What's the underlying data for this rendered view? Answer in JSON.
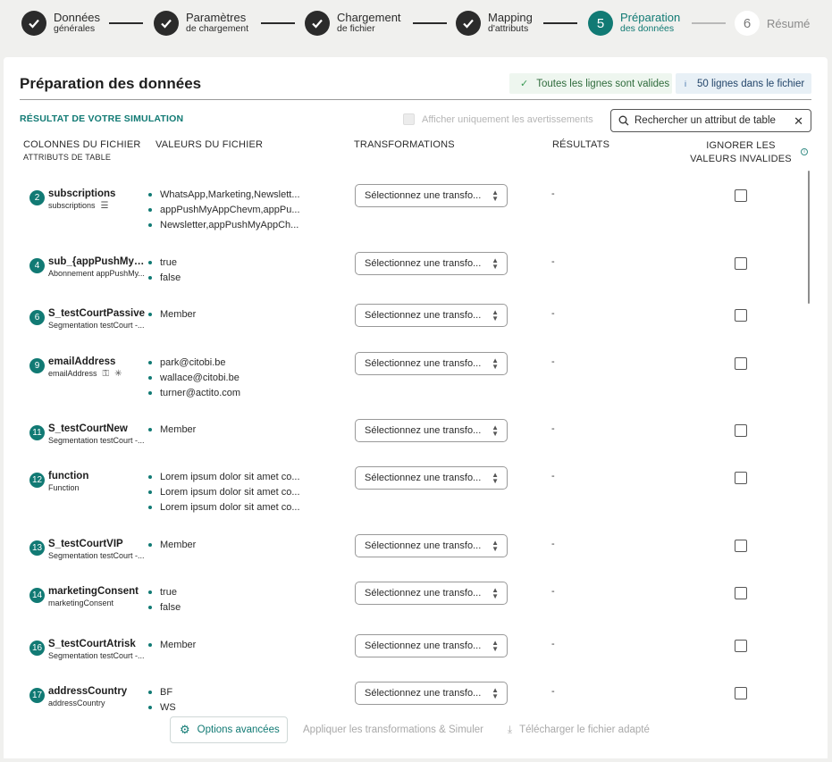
{
  "stepper": {
    "steps": [
      {
        "main": "Données",
        "sub": "générales",
        "state": "done"
      },
      {
        "main": "Paramètres",
        "sub": "de chargement",
        "state": "done"
      },
      {
        "main": "Chargement",
        "sub": "de fichier",
        "state": "done"
      },
      {
        "main": "Mapping",
        "sub": "d'attributs",
        "state": "done"
      },
      {
        "number": "5",
        "main": "Préparation",
        "sub": "des données",
        "state": "active"
      },
      {
        "number": "6",
        "main": "Résumé",
        "sub": "",
        "state": "future"
      }
    ]
  },
  "header": {
    "title": "Préparation des données",
    "valid_badge": "Toutes les lignes sont valides",
    "lines_badge": "50 lignes dans le fichier"
  },
  "toolbar": {
    "simulation_label": "RÉSULTAT DE VOTRE SIMULATION",
    "warnings_only_label": "Afficher uniquement les avertissements",
    "search_placeholder": "Rechercher un attribut de table"
  },
  "columns": {
    "file_columns": "COLONNES DU FICHIER",
    "table_attributes": "ATTRIBUTS DE TABLE",
    "file_values": "VALEURS DU FICHIER",
    "transformations": "TRANSFORMATIONS",
    "results": "RÉSULTATS",
    "ignore_line1": "IGNORER LES",
    "ignore_line2": "VALEURS INVALIDES"
  },
  "select_placeholder": "Sélectionnez une transfo...",
  "rows": [
    {
      "num": "2",
      "name": "subscriptions",
      "sub": "subscriptions",
      "icons": [
        "list-icon"
      ],
      "values": [
        "WhatsApp,Marketing,Newslett...",
        "appPushMyAppChevm,appPu...",
        "Newsletter,appPushMyAppCh..."
      ],
      "result": "-",
      "ignore": false
    },
    {
      "num": "4",
      "name": "sub_{appPushMyAp...",
      "sub": "Abonnement appPushMy...",
      "icons": [],
      "values": [
        "true",
        "false"
      ],
      "result": "-",
      "ignore": false
    },
    {
      "num": "6",
      "name": "S_testCourtPassive",
      "sub": "Segmentation testCourt -...",
      "icons": [],
      "values": [
        "Member"
      ],
      "result": "-",
      "ignore": false
    },
    {
      "num": "9",
      "name": "emailAddress",
      "sub": "emailAddress",
      "icons": [
        "key-icon",
        "asterisk-icon"
      ],
      "values": [
        "park@citobi.be",
        "wallace@citobi.be",
        "turner@actito.com"
      ],
      "result": "-",
      "ignore": false
    },
    {
      "num": "11",
      "name": "S_testCourtNew",
      "sub": "Segmentation testCourt -...",
      "icons": [],
      "values": [
        "Member"
      ],
      "result": "-",
      "ignore": false
    },
    {
      "num": "12",
      "name": "function",
      "sub": "Function",
      "icons": [],
      "values": [
        "Lorem ipsum dolor sit amet co...",
        "Lorem ipsum dolor sit amet co...",
        "Lorem ipsum dolor sit amet co..."
      ],
      "result": "-",
      "ignore": false
    },
    {
      "num": "13",
      "name": "S_testCourtVIP",
      "sub": "Segmentation testCourt -...",
      "icons": [],
      "values": [
        "Member"
      ],
      "result": "-",
      "ignore": false
    },
    {
      "num": "14",
      "name": "marketingConsent",
      "sub": "marketingConsent",
      "icons": [],
      "values": [
        "true",
        "false"
      ],
      "result": "-",
      "ignore": false
    },
    {
      "num": "16",
      "name": "S_testCourtAtrisk",
      "sub": "Segmentation testCourt -...",
      "icons": [],
      "values": [
        "Member"
      ],
      "result": "-",
      "ignore": false
    },
    {
      "num": "17",
      "name": "addressCountry",
      "sub": "addressCountry",
      "icons": [],
      "values": [
        "BF",
        "WS"
      ],
      "result": "-",
      "ignore": false
    }
  ],
  "footer": {
    "advanced_options": "Options avancées",
    "apply_simulate": "Appliquer les transformations & Simuler",
    "download": "Télécharger le fichier adapté"
  }
}
